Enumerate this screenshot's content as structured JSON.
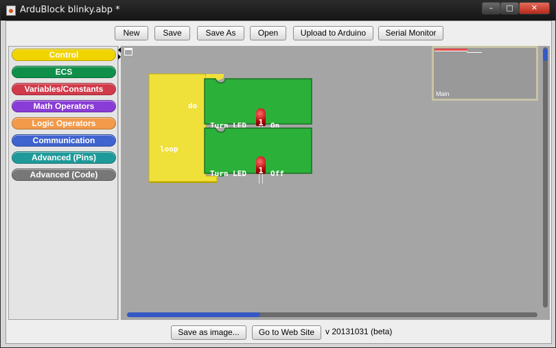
{
  "window": {
    "title": "ArduBlock blinky.abp *",
    "minimize": "–",
    "maximize": "□",
    "close": "✕"
  },
  "toolbar": {
    "new": "New",
    "save": "Save",
    "save_as": "Save As",
    "open": "Open",
    "upload": "Upload to Arduino",
    "serial_monitor": "Serial Monitor"
  },
  "palette": {
    "items": [
      {
        "label": "Control",
        "color": "#f0d400"
      },
      {
        "label": "ECS",
        "color": "#0f8f4a"
      },
      {
        "label": "Variables/Constants",
        "color": "#d13a4a"
      },
      {
        "label": "Math Operators",
        "color": "#8a3cd6"
      },
      {
        "label": "Logic Operators",
        "color": "#f29a4a"
      },
      {
        "label": "Communication",
        "color": "#3f63cf"
      },
      {
        "label": "Advanced (Pins)",
        "color": "#1f9a9a"
      },
      {
        "label": "Advanced (Code)",
        "color": "#777777"
      }
    ]
  },
  "workspace": {
    "loop_block": {
      "label": "loop",
      "do_label": "do",
      "color": "#f0e03a"
    },
    "statements": [
      {
        "text": "Turn LED",
        "pin": "1",
        "state": "On",
        "color": "#2bb03a"
      },
      {
        "text": "Turn LED",
        "pin": "1",
        "state": "Off",
        "color": "#2bb03a"
      }
    ],
    "minimap": {
      "label": "Main"
    }
  },
  "footer": {
    "save_image": "Save as image...",
    "web_site": "Go to Web Site",
    "version": "v 20131031 (beta)"
  },
  "colors": {
    "accent": "#3559c4",
    "workspace_bg": "#a5a5a5"
  }
}
